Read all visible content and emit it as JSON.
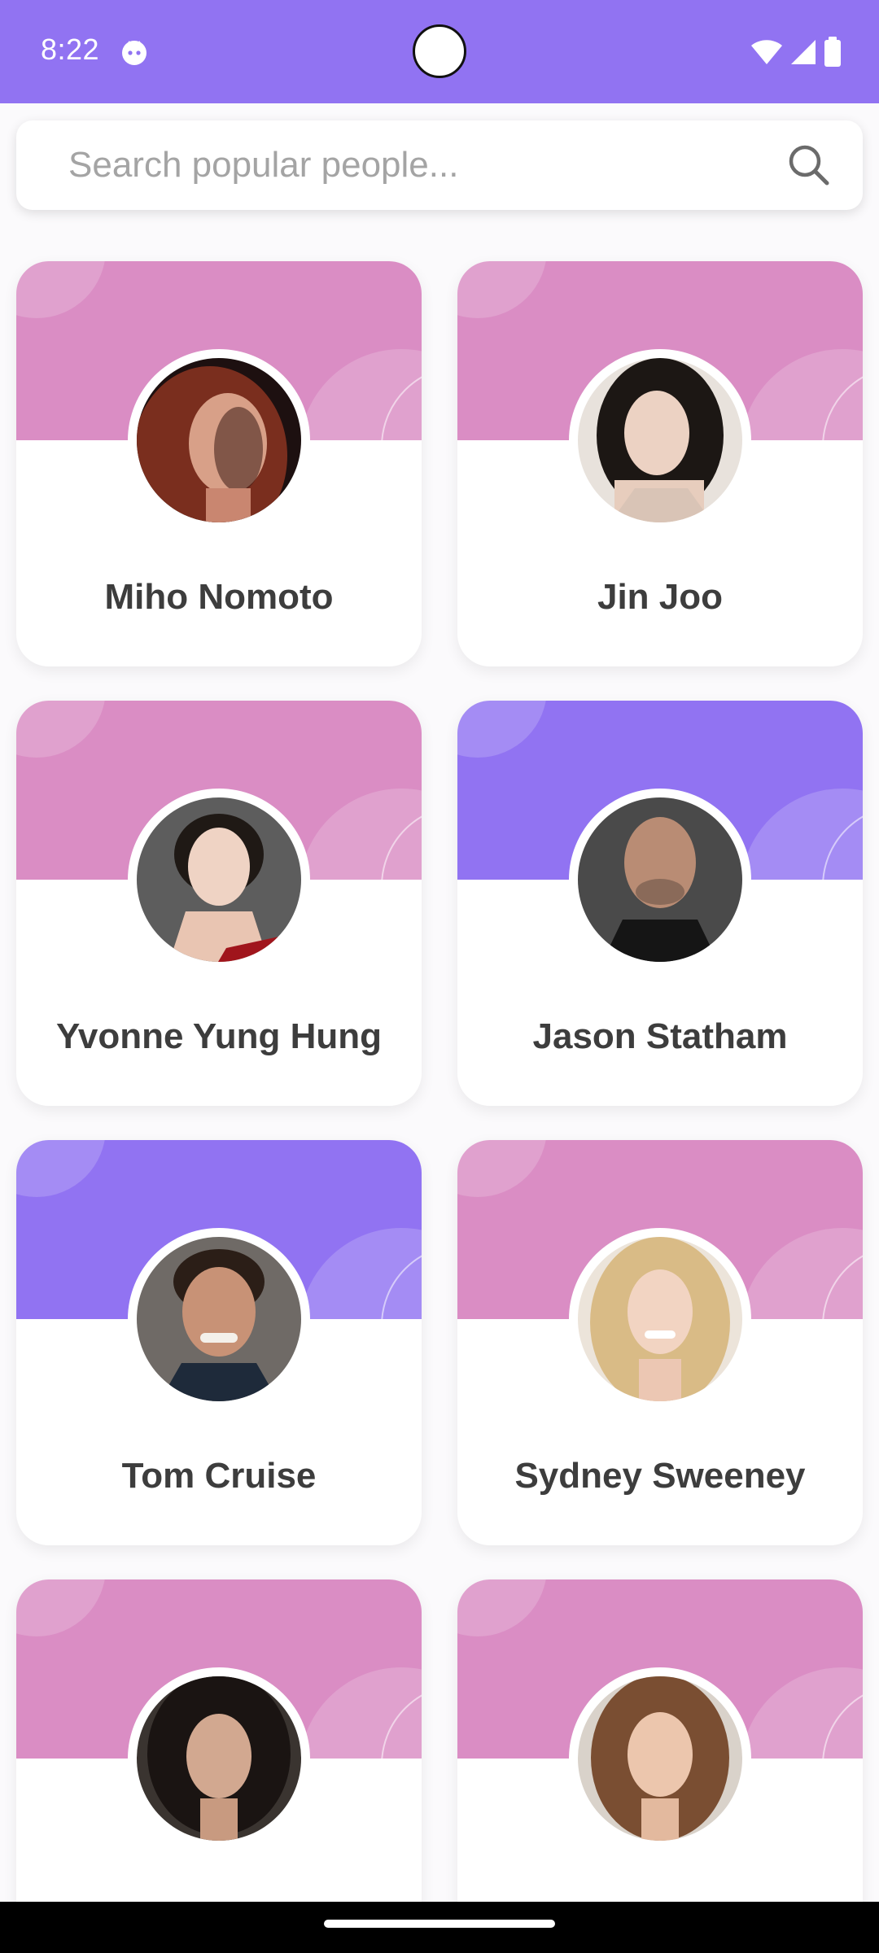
{
  "status_bar": {
    "time": "8:22",
    "background_color": "#9173f2",
    "icons": [
      "notification-app-icon",
      "wifi-icon",
      "signal-icon",
      "battery-icon"
    ]
  },
  "search": {
    "placeholder": "Search popular people...",
    "value": "",
    "icon": "search-icon"
  },
  "colors": {
    "accent_purple": "#9173f2",
    "banner_pink": "#da8dc4",
    "card_background": "#ffffff",
    "name_text": "#3d3d3d"
  },
  "people": [
    {
      "name": "Miho Nomoto",
      "banner_color": "#da8dc4",
      "avatar_tone": "#a04a32"
    },
    {
      "name": "Jin Joo",
      "banner_color": "#da8dc4",
      "avatar_tone": "#c9b2a4"
    },
    {
      "name": "Yvonne Yung Hung",
      "banner_color": "#da8dc4",
      "avatar_tone": "#6a6a6a"
    },
    {
      "name": "Jason Statham",
      "banner_color": "#9173f2",
      "avatar_tone": "#5c5c5c"
    },
    {
      "name": "Tom Cruise",
      "banner_color": "#9173f2",
      "avatar_tone": "#6b5a4e"
    },
    {
      "name": "Sydney Sweeney",
      "banner_color": "#da8dc4",
      "avatar_tone": "#e5d7c7"
    },
    {
      "name": "",
      "banner_color": "#da8dc4",
      "avatar_tone": "#2c2622"
    },
    {
      "name": "",
      "banner_color": "#da8dc4",
      "avatar_tone": "#8a5c3d"
    }
  ]
}
